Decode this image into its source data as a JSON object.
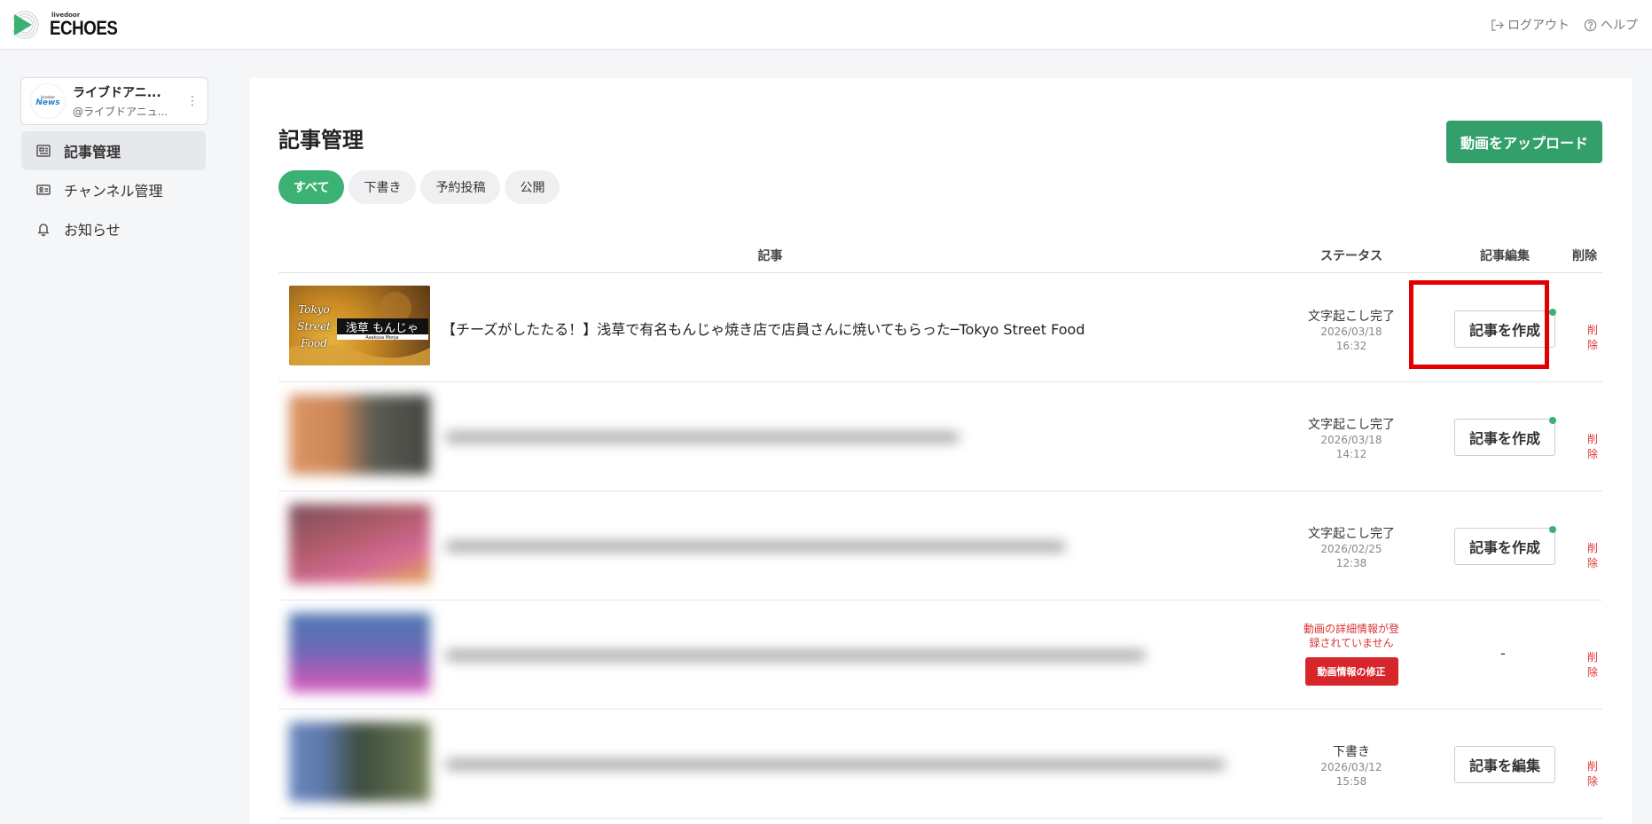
{
  "header": {
    "logo_small": "livedoor",
    "logo_text": "ECHOES",
    "logout_label": "ログアウト",
    "help_label": "ヘルプ"
  },
  "account": {
    "avatar_small": "livedoor",
    "avatar_brand": "News",
    "name": "ライブドアニ...",
    "handle": "@ライブドアニュ..."
  },
  "sidebar": {
    "items": [
      {
        "label": "記事管理",
        "icon": "newspaper-icon"
      },
      {
        "label": "チャンネル管理",
        "icon": "id-card-icon"
      },
      {
        "label": "お知らせ",
        "icon": "bell-icon"
      }
    ]
  },
  "main": {
    "title": "記事管理",
    "upload_label": "動画をアップロード",
    "filters": [
      "すべて",
      "下書き",
      "予約投稿",
      "公開"
    ],
    "columns": [
      "記事",
      "ステータス",
      "記事編集",
      "削除"
    ]
  },
  "rows": [
    {
      "title": "【チーズがしたたる！】浅草で有名もんじゃ焼き店で店員さんに焼いてもらった─Tokyo Street Food",
      "thumb_text_left": "Tokyo Street Food",
      "thumb_text_banner": "浅草 もんじゃ",
      "thumb_text_sub": "Asakusa Monja",
      "status": "文字起こし完了",
      "date": "2026/03/18",
      "time": "16:32",
      "edit_label": "記事を作成",
      "delete_label": "削除"
    },
    {
      "status": "文字起こし完了",
      "date": "2026/03/18",
      "time": "14:12",
      "edit_label": "記事を作成",
      "delete_label": "削除"
    },
    {
      "status": "文字起こし完了",
      "date": "2026/02/25",
      "time": "12:38",
      "edit_label": "記事を作成",
      "delete_label": "削除"
    },
    {
      "error_line1": "動画の詳細情報が登",
      "error_line2": "録されていません",
      "fix_label": "動画情報の修正",
      "edit_label": "-",
      "delete_label": "削除"
    },
    {
      "status": "下書き",
      "date": "2026/03/12",
      "time": "15:58",
      "edit_label": "記事を編集",
      "delete_label": "削除"
    }
  ],
  "colors": {
    "brand_green": "#33a06b",
    "filter_active": "#3bb273",
    "error_red": "#d6262c",
    "highlight": "#e00000"
  }
}
